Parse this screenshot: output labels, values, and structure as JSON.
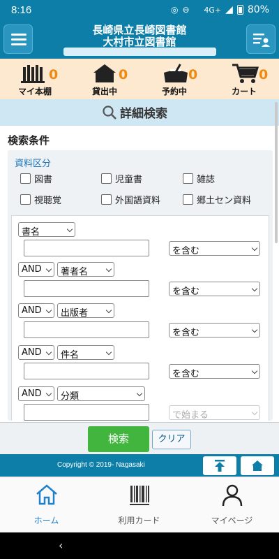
{
  "status": {
    "time": "8:16",
    "network": "4G+",
    "battery": "80%"
  },
  "header": {
    "title_line1": "長崎県立長崎図書館",
    "title_line2": "大村市立図書館"
  },
  "quick": [
    {
      "label": "マイ本棚",
      "count": "0",
      "icon": "bookshelf-icon"
    },
    {
      "label": "貸出中",
      "count": "0",
      "icon": "house-icon"
    },
    {
      "label": "予約中",
      "count": "0",
      "icon": "reserve-icon"
    },
    {
      "label": "カート",
      "count": "0",
      "icon": "cart-icon"
    }
  ],
  "search_title": "詳細検索",
  "conditions_label": "検索条件",
  "category": {
    "title": "資料区分",
    "options": [
      "図書",
      "児童書",
      "雑誌",
      "視聴覚",
      "外国語資料",
      "郷土セン資料"
    ]
  },
  "rows": [
    {
      "operator": "",
      "field": "書名",
      "match": "を含む",
      "match_disabled": false
    },
    {
      "operator": "AND",
      "field": "著者名",
      "match": "を含む",
      "match_disabled": false
    },
    {
      "operator": "AND",
      "field": "出版者",
      "match": "を含む",
      "match_disabled": false
    },
    {
      "operator": "AND",
      "field": "件名",
      "match": "を含む",
      "match_disabled": false
    },
    {
      "operator": "AND",
      "field": "分類",
      "match": "で始まる",
      "match_disabled": true
    }
  ],
  "actions": {
    "search": "検索",
    "clear": "クリア"
  },
  "footer": {
    "copyright": "Copyright © 2019- Nagasaki"
  },
  "bottom_nav": [
    {
      "label": "ホーム",
      "active": true
    },
    {
      "label": "利用カード",
      "active": false
    },
    {
      "label": "マイページ",
      "active": false
    }
  ],
  "colors": {
    "primary": "#0c7ea8",
    "accent_orange": "#ee8a10",
    "search_green": "#41b53d",
    "quick_bg": "#fde9d0"
  }
}
